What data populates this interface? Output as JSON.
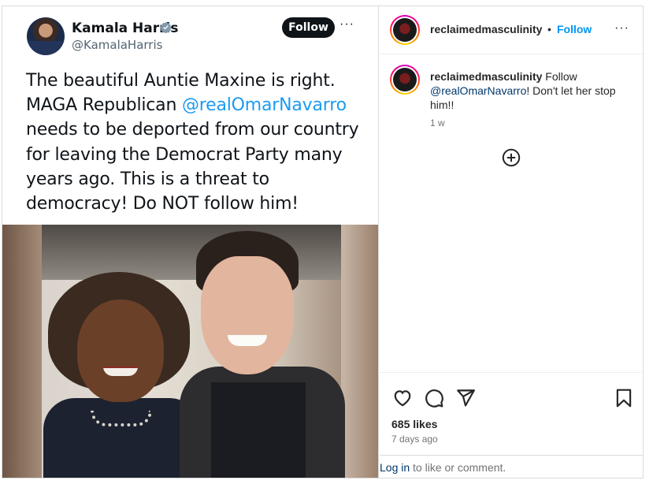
{
  "tweet": {
    "name": "Kamala Harris",
    "handle": "@KamalaHarris",
    "follow_label": "Follow",
    "more_label": "···",
    "text_before": "The beautiful Auntie Maxine is right. MAGA Republican ",
    "mention": "@realOmarNavarro",
    "text_after": " needs to be deported from our country for leaving the Democrat Party many years ago. This is a threat to democracy! Do NOT follow him!",
    "verified_icon": "verified-badge-icon"
  },
  "post": {
    "username": "reclaimedmasculinity",
    "dot": "•",
    "follow_label": "Follow",
    "more_label": "···",
    "caption_user": "reclaimedmasculinity",
    "caption_text_before": " Follow ",
    "caption_mention": "@realOmarNavarro",
    "caption_text_after": "! Don't let her stop him!!",
    "caption_time": "1 w",
    "likes": "685 likes",
    "time_ago": "7 days ago",
    "login_link": "Log in",
    "login_rest": " to like or comment."
  },
  "colors": {
    "accent": "#0095f6",
    "tweet_mention": "#1d9bf0",
    "ig_link": "#00376b"
  }
}
